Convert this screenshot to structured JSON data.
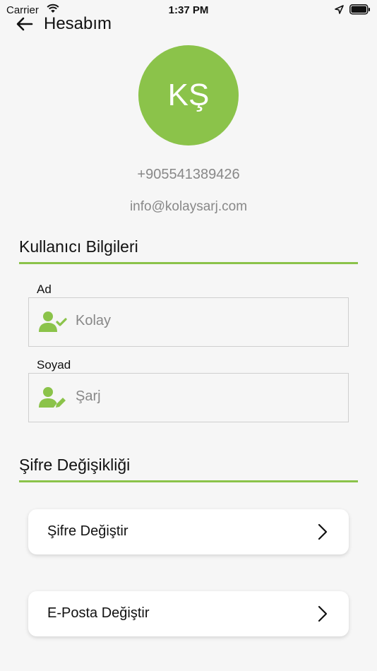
{
  "status_bar": {
    "carrier": "Carrier",
    "time": "1:37 PM"
  },
  "header": {
    "title": "Hesabım"
  },
  "profile": {
    "initials": "KŞ",
    "phone": "+905541389426",
    "email": "info@kolaysarj.com",
    "avatar_color": "#8bc34a"
  },
  "user_info": {
    "section_title": "Kullanıcı Bilgileri",
    "first_name": {
      "label": "Ad",
      "value": "Kolay",
      "icon": "user-check-icon"
    },
    "last_name": {
      "label": "Soyad",
      "value": "Şarj",
      "icon": "user-edit-icon"
    }
  },
  "password_section": {
    "section_title": "Şifre Değişikliği",
    "change_password_label": "Şifre Değiştir",
    "change_email_label": "E-Posta Değiştir"
  },
  "colors": {
    "accent": "#8bc34a",
    "muted_text": "#888888",
    "background": "#f6f6f6"
  }
}
